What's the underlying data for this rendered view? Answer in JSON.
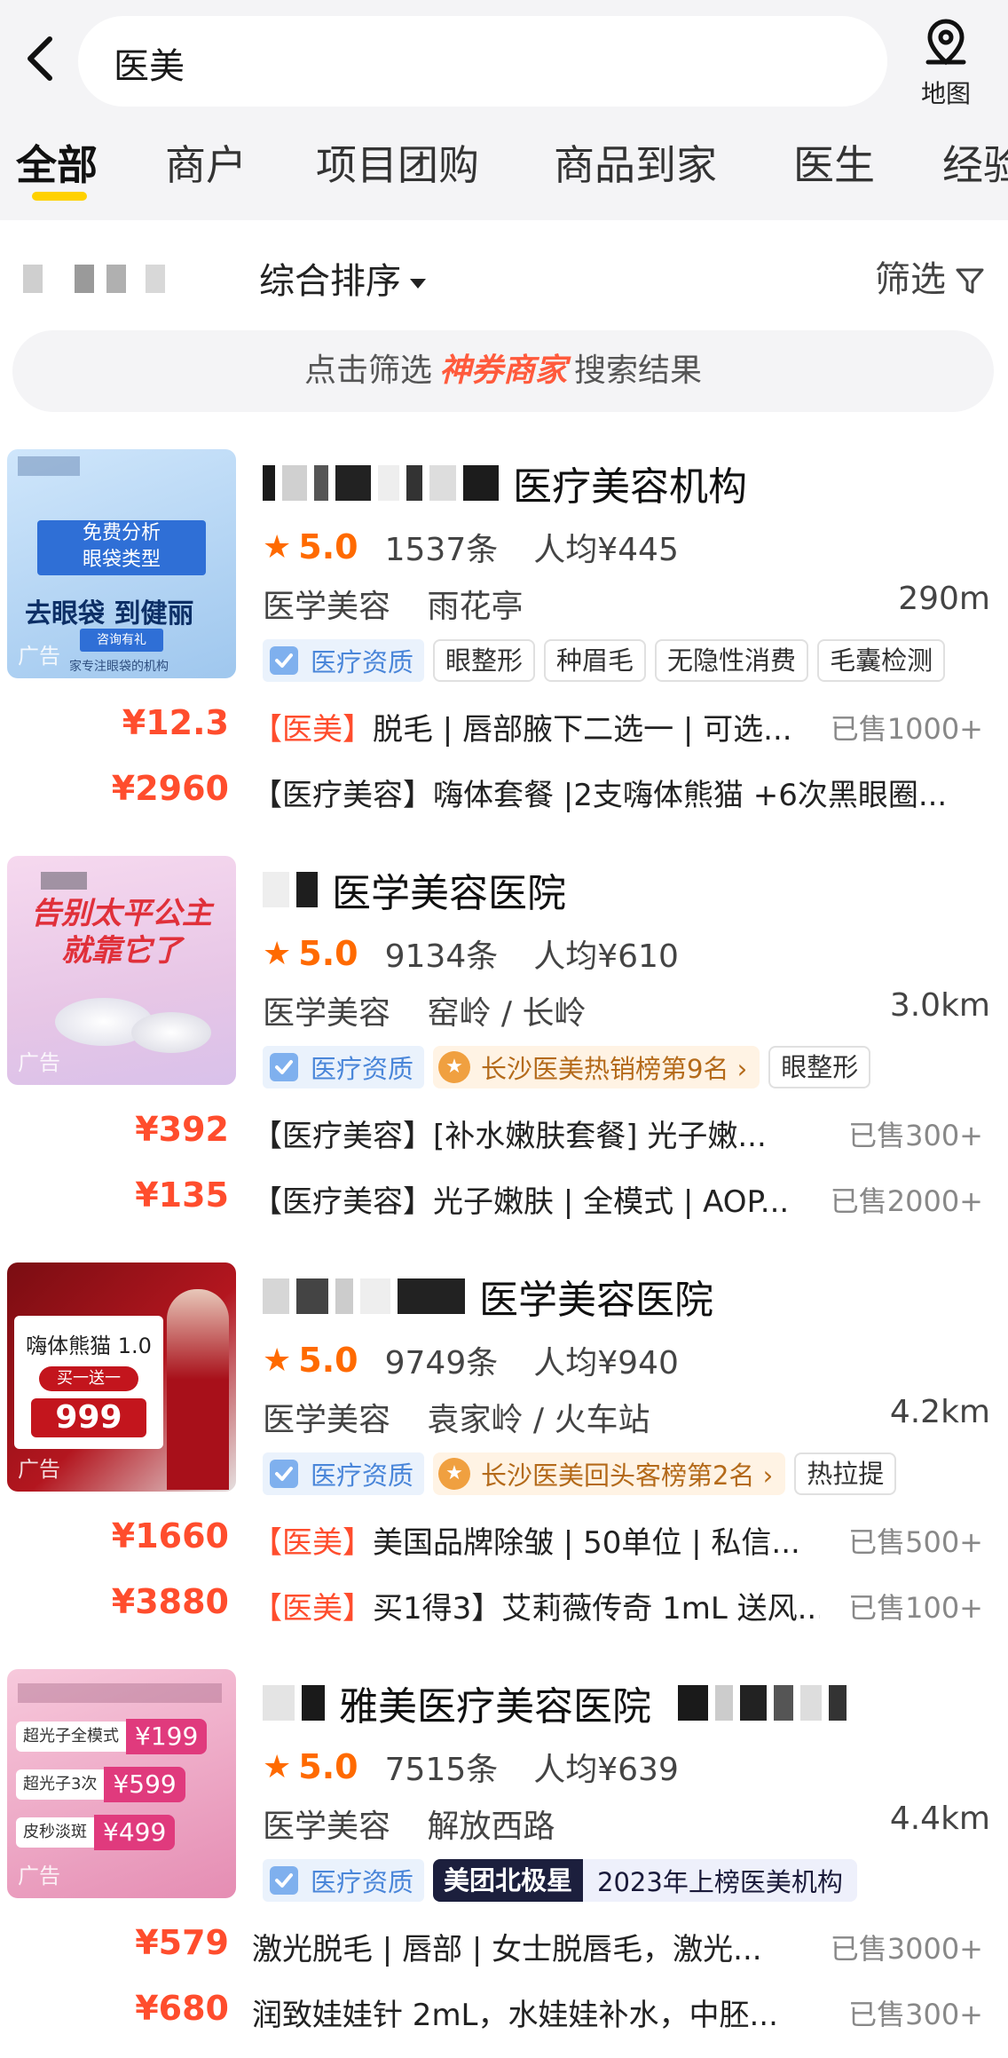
{
  "search": {
    "query": "医美",
    "map_label": "地图"
  },
  "tabs": [
    "全部",
    "商户",
    "项目团购",
    "商品到家",
    "医生",
    "经验"
  ],
  "sortbar": {
    "sort_label": "综合排序",
    "filter_label": "筛选"
  },
  "banner": {
    "prefix": "点击筛选",
    "highlight": "神券商家",
    "suffix": "搜索结果"
  },
  "colors": {
    "accent": "#ff4d2d",
    "tab_indicator": "#ffd100",
    "rating": "#ff6a00"
  },
  "shops": [
    {
      "name": "医疗美容机构",
      "rating": "5.0",
      "reviews": "1537条",
      "avg_price": "人均¥445",
      "category": "医学美容",
      "area": "雨花亭",
      "distance": "290m",
      "qual_tag": "医疗资质",
      "tags": [
        "眼整形",
        "种眉毛",
        "无隐性消费",
        "毛囊检测"
      ],
      "thumb": {
        "ad": "广告",
        "line1": "免费分析",
        "line2": "眼袋类型",
        "line3": "去眼袋 到健丽",
        "line4": "咨询有礼",
        "line5": "家专注眼袋的机构"
      },
      "deals": [
        {
          "price": "¥12.3",
          "cat": "【医美】",
          "title": "脱毛 | 唇部腋下二选一 | 可选...",
          "sold": "已售1000+"
        },
        {
          "price": "¥2960",
          "cat": "【医疗美容】",
          "title": "嗨体套餐 |2支嗨体熊猫 +6次黑眼圈...",
          "sold": ""
        }
      ]
    },
    {
      "name": "医学美容医院",
      "rating": "5.0",
      "reviews": "9134条",
      "avg_price": "人均¥610",
      "category": "医学美容",
      "area": "窑岭 / 长岭",
      "distance": "3.0km",
      "qual_tag": "医疗资质",
      "rank_tag": "长沙医美热销榜第9名 ›",
      "tags": [
        "眼整形"
      ],
      "thumb": {
        "ad": "广告",
        "line1": "告别太平公主",
        "line2": "就靠它了"
      },
      "deals": [
        {
          "price": "¥392",
          "cat": "【医疗美容】",
          "title": "[补水嫩肤套餐] 光子嫩...",
          "sold": "已售300+"
        },
        {
          "price": "¥135",
          "cat": "【医疗美容】",
          "title": "光子嫩肤 | 全模式 | AOP...",
          "sold": "已售2000+"
        }
      ]
    },
    {
      "name": "医学美容医院",
      "rating": "5.0",
      "reviews": "9749条",
      "avg_price": "人均¥940",
      "category": "医学美容",
      "area": "袁家岭 / 火车站",
      "distance": "4.2km",
      "qual_tag": "医疗资质",
      "rank_tag": "长沙医美回头客榜第2名 ›",
      "tags": [
        "热拉提"
      ],
      "thumb": {
        "ad": "广告",
        "line1": "嗨体熊猫 1.0",
        "line2": "买一送一",
        "line3": "999"
      },
      "deals": [
        {
          "price": "¥1660",
          "cat": "【医美】",
          "title": "美国品牌除皱 | 50单位 | 私信...",
          "sold": "已售500+"
        },
        {
          "price": "¥3880",
          "cat": "【医美】",
          "title": "买1得3】艾莉薇传奇 1mL 送风...",
          "sold": "已售100+"
        }
      ]
    },
    {
      "name": "雅美医疗美容医院",
      "rating": "5.0",
      "reviews": "7515条",
      "avg_price": "人均¥639",
      "category": "医学美容",
      "area": "解放西路",
      "distance": "4.4km",
      "qual_tag": "医疗资质",
      "mt_tag_left": "美团北极星",
      "mt_tag_right": "2023年上榜医美机构",
      "thumb": {
        "ad": "广告",
        "r1l": "超光子全模式",
        "r1p": "¥199",
        "r2l": "超光子3次",
        "r2p": "¥599",
        "r3l": "皮秒淡斑",
        "r3p": "¥499"
      },
      "deals": [
        {
          "price": "¥579",
          "cat": "",
          "title": "激光脱毛 | 唇部 | 女士脱唇毛，激光...",
          "sold": "已售3000+"
        },
        {
          "price": "¥680",
          "cat": "",
          "title": "润致娃娃针 2mL，水娃娃补水，中胚...",
          "sold": "已售300+"
        }
      ]
    }
  ]
}
